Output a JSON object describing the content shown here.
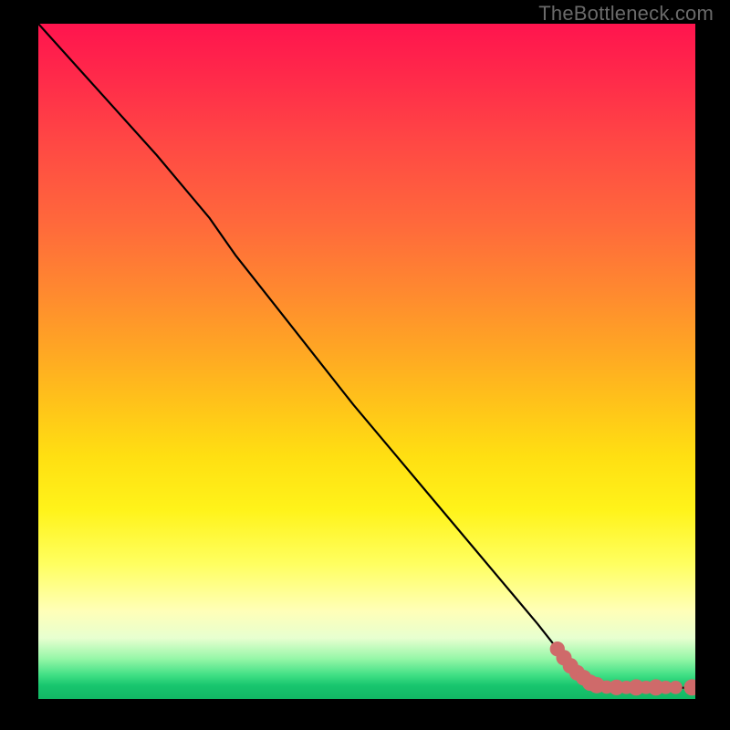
{
  "watermark": "TheBottleneck.com",
  "colors": {
    "line": "#000000",
    "dots": "#cf6a6a",
    "dot_fill": "#cf6a6a"
  },
  "chart_data": {
    "type": "line",
    "title": "",
    "xlabel": "",
    "ylabel": "",
    "xlim": [
      0,
      100
    ],
    "ylim": [
      0,
      108
    ],
    "grid": false,
    "series": [
      {
        "name": "curve",
        "x": [
          0,
          6,
          12,
          18,
          22,
          26,
          30,
          36,
          42,
          48,
          54,
          60,
          66,
          72,
          76,
          79,
          80.5,
          82,
          83,
          84,
          86,
          88,
          90,
          92,
          94,
          96,
          98,
          100
        ],
        "y": [
          108,
          101,
          94,
          87,
          82,
          77,
          71,
          63,
          55,
          47,
          39.5,
          32,
          24.5,
          17,
          12,
          8,
          6,
          4.2,
          3.2,
          2.6,
          2.1,
          1.9,
          1.8,
          1.8,
          1.8,
          1.8,
          1.8,
          1.8
        ]
      }
    ],
    "dots": {
      "name": "flat-region-markers",
      "points": [
        {
          "x": 79.0,
          "y": 8.0,
          "r": 1.5
        },
        {
          "x": 80.0,
          "y": 6.6,
          "r": 1.6
        },
        {
          "x": 81.0,
          "y": 5.3,
          "r": 1.6
        },
        {
          "x": 82.0,
          "y": 4.2,
          "r": 1.6
        },
        {
          "x": 83.0,
          "y": 3.4,
          "r": 1.6
        },
        {
          "x": 84.0,
          "y": 2.6,
          "r": 1.7
        },
        {
          "x": 85.0,
          "y": 2.2,
          "r": 1.7
        },
        {
          "x": 86.5,
          "y": 1.9,
          "r": 1.3
        },
        {
          "x": 88.0,
          "y": 1.85,
          "r": 1.6
        },
        {
          "x": 89.5,
          "y": 1.85,
          "r": 1.3
        },
        {
          "x": 91.0,
          "y": 1.85,
          "r": 1.7
        },
        {
          "x": 92.5,
          "y": 1.85,
          "r": 1.3
        },
        {
          "x": 94.0,
          "y": 1.85,
          "r": 1.7
        },
        {
          "x": 95.5,
          "y": 1.85,
          "r": 1.3
        },
        {
          "x": 97.0,
          "y": 1.85,
          "r": 1.3
        },
        {
          "x": 99.5,
          "y": 1.85,
          "r": 1.7
        }
      ]
    }
  }
}
